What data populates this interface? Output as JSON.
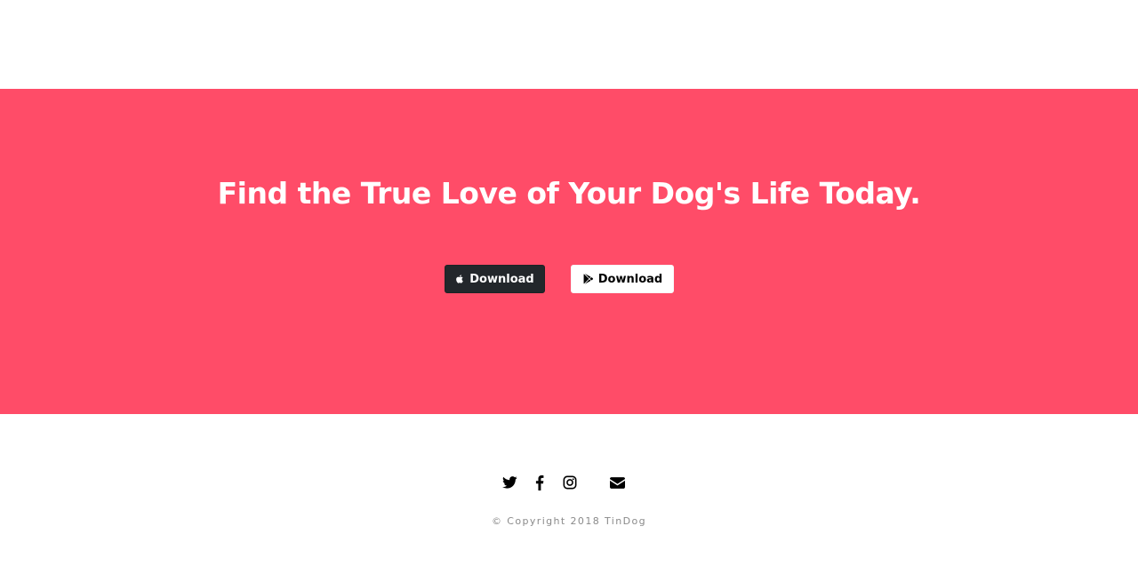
{
  "cta": {
    "heading": "Find the True Love of Your Dog's Life Today.",
    "apple_button": {
      "label": "Download",
      "icon": "apple-icon"
    },
    "play_button": {
      "label": "Download",
      "icon": "google-play-icon"
    },
    "background_color": "#ff4c68"
  },
  "footer": {
    "social_icons": [
      "twitter-icon",
      "facebook-icon",
      "instagram-icon",
      "envelope-icon"
    ],
    "copyright": "© Copyright 2018 TinDog"
  }
}
